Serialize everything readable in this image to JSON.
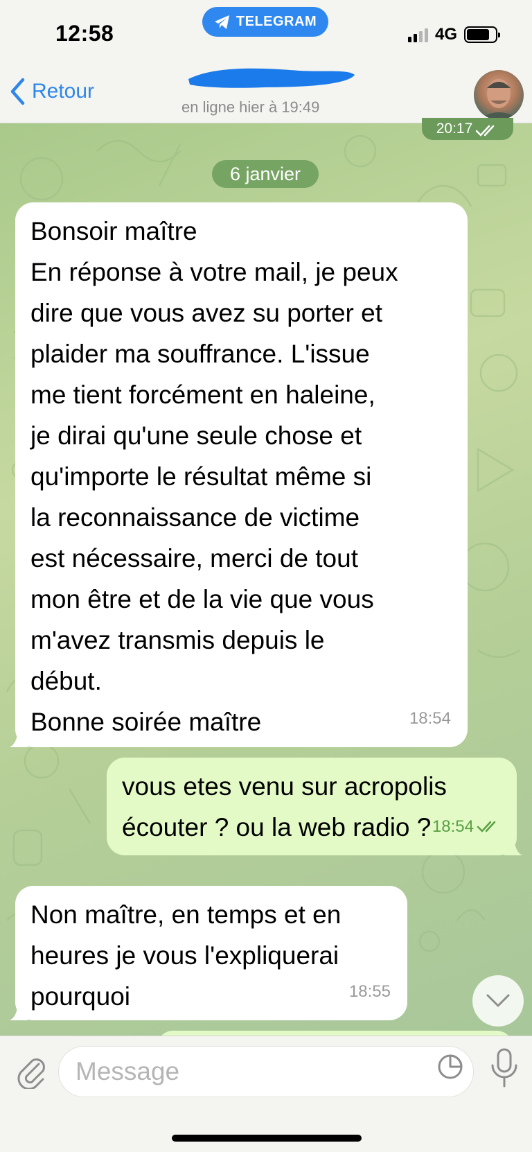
{
  "status_bar": {
    "time": "12:58",
    "app_pill": "TELEGRAM",
    "network": "4G",
    "signal_bars": 2,
    "signal_max": 4,
    "battery_level": 0.8
  },
  "header": {
    "back_label": "Retour",
    "contact_status": "en ligne hier à 19:49",
    "name_redacted": true
  },
  "chat": {
    "prev_message_time": "20:17",
    "date_separator": "6 janvier",
    "messages": [
      {
        "direction": "incoming",
        "text": "Bonsoir maître\nEn réponse à votre mail, je peux\ndire que vous avez su porter et\nplaider ma souffrance. L'issue\nme tient forcément en haleine,\nje dirai qu'une seule chose et\nqu'importe le résultat même si\nla reconnaissance de victime\nest nécessaire, merci de tout\nmon être et de la vie que vous\nm'avez transmis depuis le\ndébut.\nBonne soirée maître",
        "time": "18:54"
      },
      {
        "direction": "outgoing",
        "text": "vous etes venu sur acropolis\nécouter ? ou la web radio ?",
        "time": "18:54",
        "read": true
      },
      {
        "direction": "incoming",
        "text": "Non maître, en temps et en\nheures je vous l'expliquerai\npourquoi",
        "time": "18:55"
      }
    ]
  },
  "input": {
    "placeholder": "Message"
  },
  "colors": {
    "accent": "#2f86ea",
    "telegram_pill": "#2f88f0",
    "incoming_bubble": "#ffffff",
    "outgoing_bubble": "#e3f9c6",
    "outgoing_meta": "#5aa044",
    "date_pill": "#76a463"
  }
}
